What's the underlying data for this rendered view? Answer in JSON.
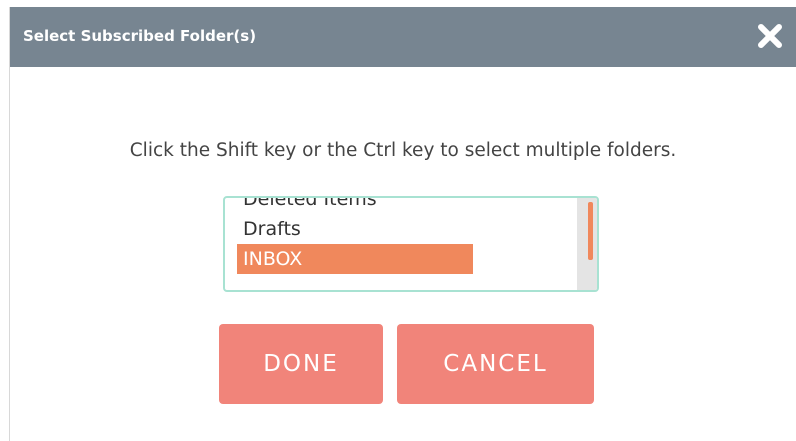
{
  "dialog": {
    "title": "Select Subscribed Folder(s)",
    "close_icon": "close-icon",
    "instructions": "Click the Shift key or the Ctrl key to select multiple folders.",
    "folders": [
      {
        "label": "Deleted Items",
        "selected": false
      },
      {
        "label": "Drafts",
        "selected": false
      },
      {
        "label": "INBOX",
        "selected": true
      }
    ],
    "buttons": {
      "done": "DONE",
      "cancel": "CANCEL"
    }
  },
  "colors": {
    "titlebar": "#778591",
    "accent": "#f0885c",
    "button": "#f1847a",
    "select_border": "#a8e2d2"
  }
}
